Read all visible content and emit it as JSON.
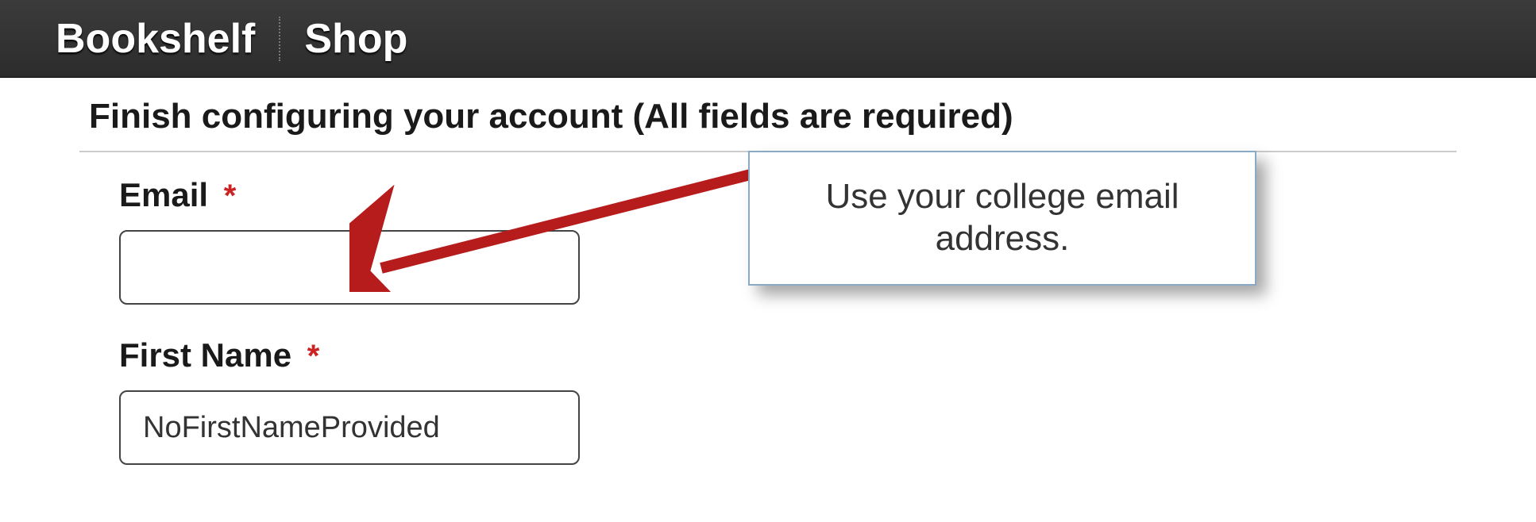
{
  "nav": {
    "bookshelf": "Bookshelf",
    "shop": "Shop"
  },
  "heading": "Finish configuring your account (All fields are required)",
  "fields": {
    "email": {
      "label": "Email",
      "value": ""
    },
    "first_name": {
      "label": "First Name",
      "value": "NoFirstNameProvided"
    }
  },
  "required_marker": "*",
  "callout": {
    "text": "Use your college email address."
  },
  "colors": {
    "navbar_bg": "#2d2d2d",
    "arrow": "#b71c1c",
    "required": "#c22"
  }
}
